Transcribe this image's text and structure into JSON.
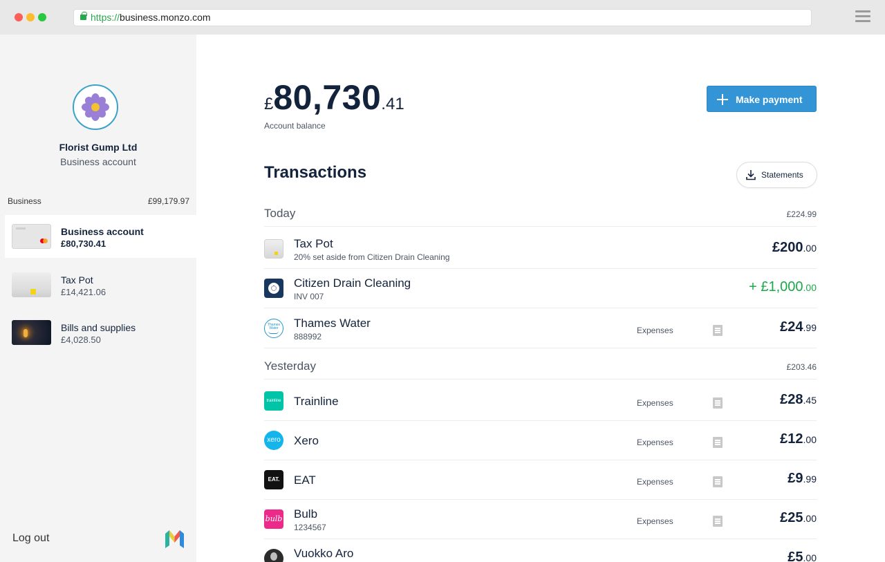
{
  "browser": {
    "url_protocol": "https://",
    "url_host": "business.monzo.com"
  },
  "sidebar": {
    "business_name": "Florist Gump Ltd",
    "business_type": "Business account",
    "group_label": "Business",
    "group_total": "£99,179.97",
    "accounts": [
      {
        "name": "Business account",
        "balance": "£80,730.41",
        "active": true
      },
      {
        "name": "Tax Pot",
        "balance": "£14,421.06",
        "active": false
      },
      {
        "name": "Bills and supplies",
        "balance": "£4,028.50",
        "active": false
      }
    ],
    "logout_label": "Log out"
  },
  "balance": {
    "currency": "£",
    "whole": "80,730",
    "pence": ".41",
    "label": "Account balance"
  },
  "actions": {
    "make_payment": "Make payment",
    "statements": "Statements"
  },
  "transactions": {
    "title": "Transactions",
    "days": [
      {
        "name": "Today",
        "total": "£224.99",
        "items": [
          {
            "name": "Tax Pot",
            "sub": "20% set aside from Citizen Drain Cleaning",
            "category": "",
            "amount_whole": "£200",
            "amount_pence": ".00",
            "credit": false,
            "logo": "taxpot"
          },
          {
            "name": "Citizen Drain Cleaning",
            "sub": "INV 007",
            "category": "",
            "amount_whole": "+ £1,000",
            "amount_pence": ".00",
            "credit": true,
            "logo": "cdc"
          },
          {
            "name": "Thames Water",
            "sub": "888992",
            "category": "Expenses",
            "amount_whole": "£24",
            "amount_pence": ".99",
            "credit": false,
            "logo": "thames"
          }
        ]
      },
      {
        "name": "Yesterday",
        "total": "£203.46",
        "items": [
          {
            "name": "Trainline",
            "sub": "",
            "category": "Expenses",
            "amount_whole": "£28",
            "amount_pence": ".45",
            "credit": false,
            "logo": "trainline"
          },
          {
            "name": "Xero",
            "sub": "",
            "category": "Expenses",
            "amount_whole": "£12",
            "amount_pence": ".00",
            "credit": false,
            "logo": "xero"
          },
          {
            "name": "EAT",
            "sub": "",
            "category": "Expenses",
            "amount_whole": "£9",
            "amount_pence": ".99",
            "credit": false,
            "logo": "eat"
          },
          {
            "name": "Bulb",
            "sub": "1234567",
            "category": "Expenses",
            "amount_whole": "£25",
            "amount_pence": ".00",
            "credit": false,
            "logo": "bulb"
          },
          {
            "name": "Vuokko Aro",
            "sub": "",
            "category": "",
            "amount_whole": "£5",
            "amount_pence": ".00",
            "credit": false,
            "logo": "vuokko"
          }
        ]
      }
    ]
  },
  "logo_text": {
    "thames": "Thames Water",
    "trainline": "trainline",
    "xero": "xero",
    "eat": "EAT.",
    "bulb": "bulb"
  },
  "colors": {
    "accent": "#3395d6",
    "credit": "#1aa84a",
    "text_dark": "#14233c"
  }
}
